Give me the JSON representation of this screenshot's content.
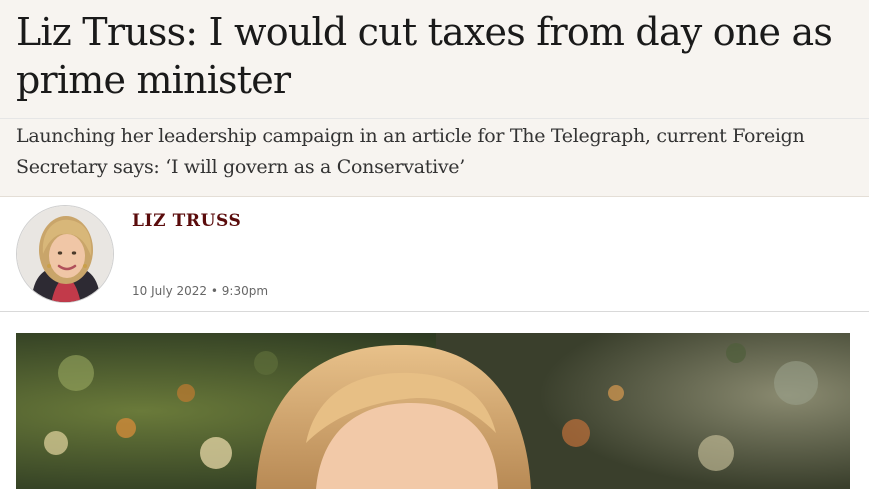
{
  "article": {
    "headline": "Liz Truss: I would cut taxes from day one as prime minister",
    "standfirst": "Launching her leadership campaign in an article for The Telegraph, current Foreign Secretary says: ‘I will govern as a Conservative’"
  },
  "byline": {
    "author": "LIZ TRUSS",
    "date": "10 July 2022",
    "separator": "•",
    "time": "9:30pm"
  },
  "colors": {
    "header_band": "#f7f4f0",
    "author_link": "#5a0b0b"
  }
}
